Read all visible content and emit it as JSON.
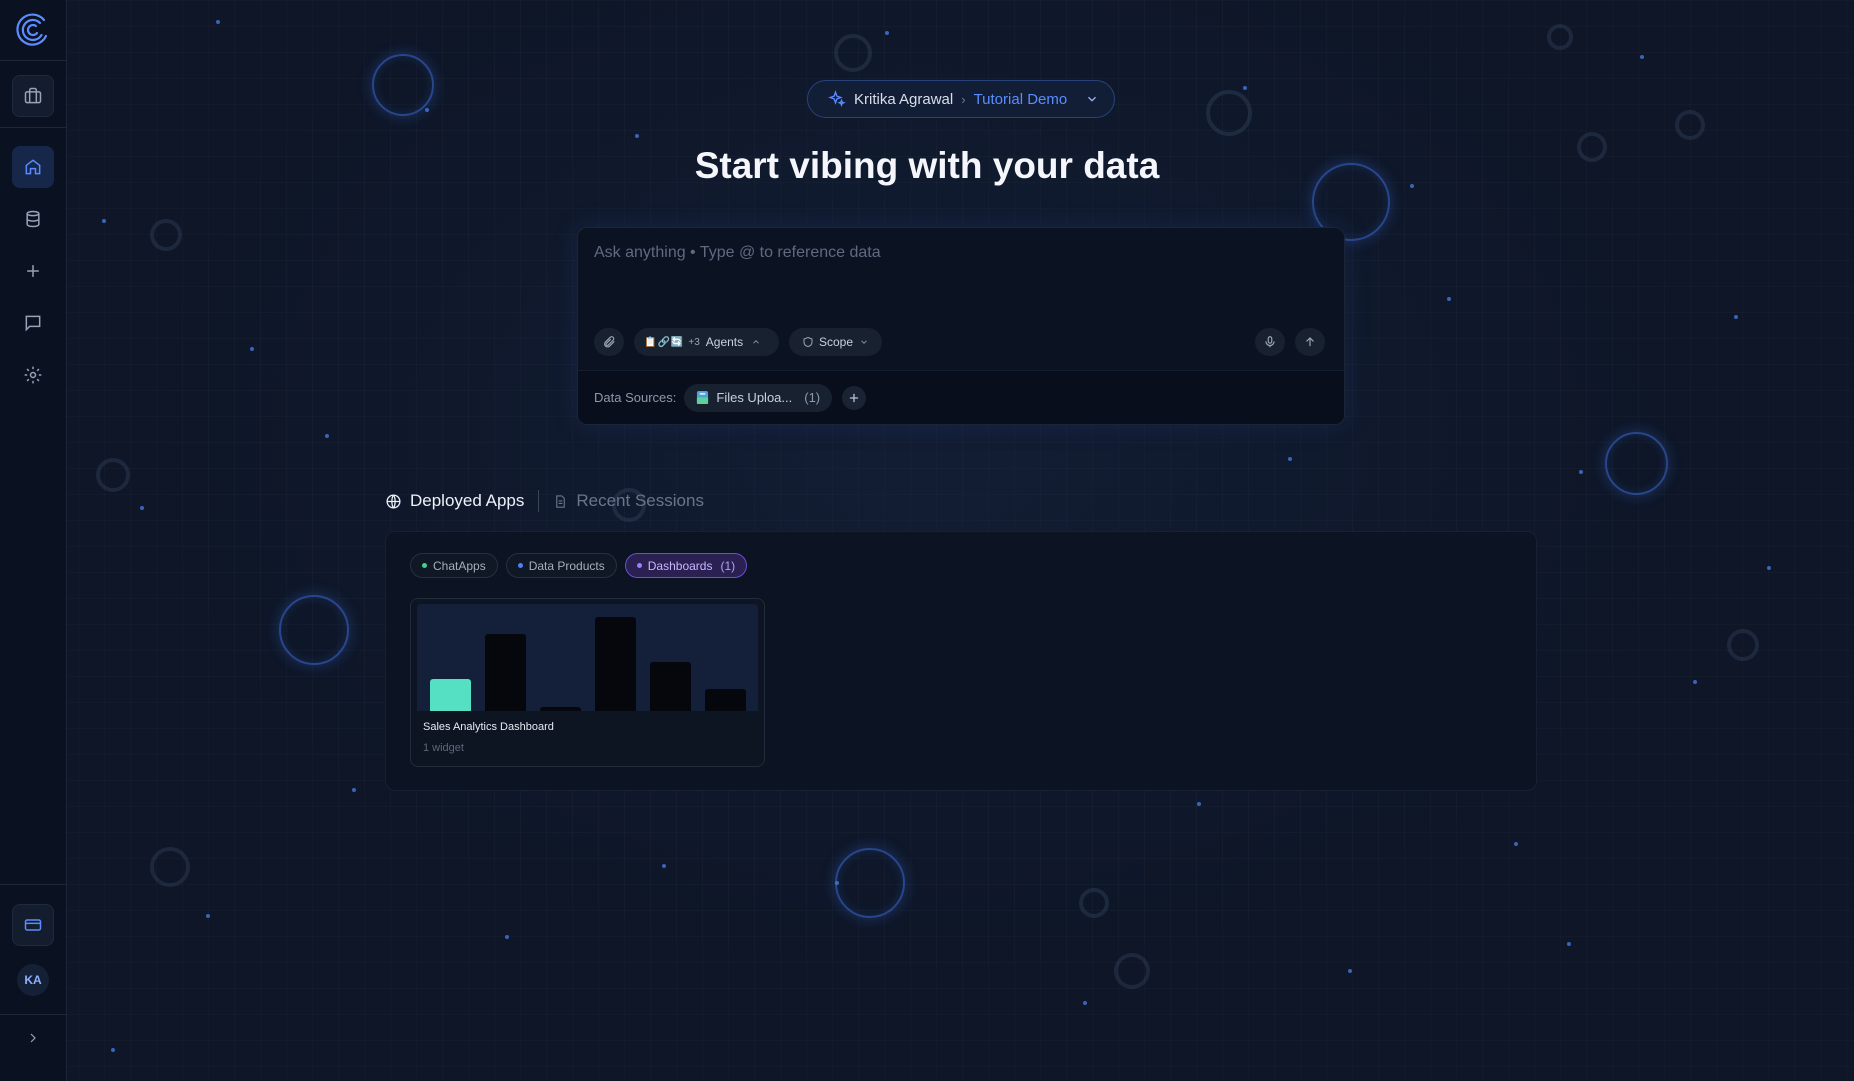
{
  "breadcrumb": {
    "user": "Kritika Agrawal",
    "separator": "›",
    "project": "Tutorial Demo"
  },
  "headline": "Start vibing with your data",
  "composer": {
    "placeholder": "Ask anything • Type @ to reference data",
    "agent_icons": "📋🔗🔄",
    "agent_more": "+3",
    "agents_label": "Agents",
    "scope_label": "Scope",
    "data_sources_label": "Data Sources:",
    "data_source": {
      "name": "Files Uploa...",
      "count": "(1)"
    }
  },
  "tabs": [
    {
      "label": "Deployed Apps",
      "active": true
    },
    {
      "label": "Recent Sessions",
      "active": false
    }
  ],
  "filters": [
    {
      "label": "ChatApps",
      "dot_color": "#3fd08f"
    },
    {
      "label": "Data Products",
      "dot_color": "#4f7dff"
    },
    {
      "label": "Dashboards",
      "count": "(1)",
      "dot_color": "#a27bff",
      "active": true
    }
  ],
  "apps": [
    {
      "title": "Sales Analytics Dashboard",
      "subtitle": "1 widget",
      "thumbnail_bar_levels": [
        0.3,
        0.72,
        0.04,
        0.88,
        0.46,
        0.21
      ],
      "highlight_index": 0
    }
  ],
  "sidebar": {
    "avatar_initials": "KA",
    "items": [
      "briefcase-icon",
      "home-icon",
      "database-icon",
      "plus-icon",
      "message-icon",
      "settings-icon",
      "billing-card-icon",
      "expand-chevron-icon"
    ]
  },
  "colors": {
    "accent": "#5b8cff",
    "highlight_bar": "#55dfc3",
    "dashboards_chip": "#6a4fcf"
  }
}
